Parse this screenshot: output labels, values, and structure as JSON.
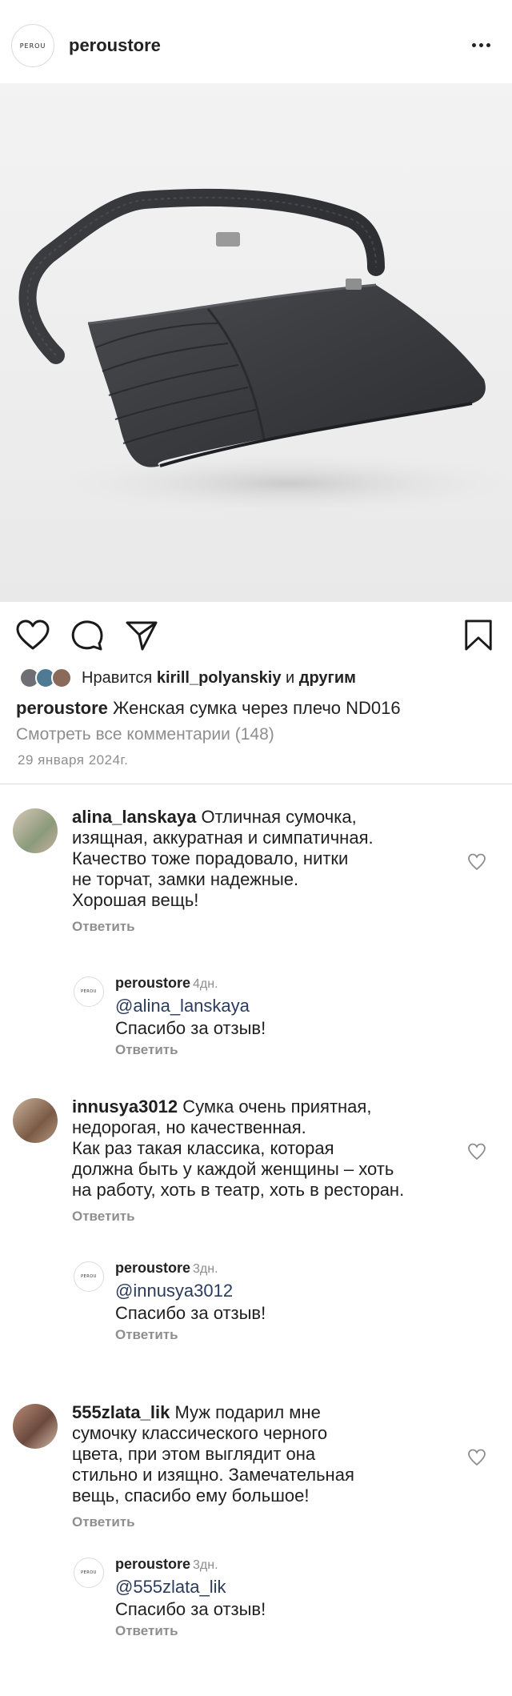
{
  "header": {
    "logo_text": "PEROU",
    "username": "peroustore"
  },
  "post": {
    "likes": {
      "prefix": "Нравится",
      "user": "kirill_polyanskiy",
      "connector": "и",
      "suffix": "другим"
    },
    "caption_user": "peroustore",
    "caption_text": "Женская сумка через плечо ND016",
    "view_comments": "Смотреть все комментарии (148)",
    "date": "29 января 2024г."
  },
  "comments": [
    {
      "user": "alina_lanskaya",
      "lines": [
        "Отличная сумочка,",
        "изящная, аккуратная и симпатичная.",
        "Качество тоже порадовало, нитки",
        "не торчат, замки надежные.",
        "Хорошая вещь!"
      ],
      "reply_label": "Ответить",
      "reply": {
        "user": "peroustore",
        "time": "4дн.",
        "mention": "@alina_lanskaya",
        "text": "Спасибо за отзыв!",
        "reply_label": "Ответить"
      }
    },
    {
      "user": "innusya3012",
      "lines": [
        "Сумка очень приятная,",
        "недорогая, но качественная.",
        "Как раз такая классика, которая",
        "должна быть у каждой женщины – хоть",
        "на работу, хоть в театр, хоть в ресторан."
      ],
      "reply_label": "Ответить",
      "reply": {
        "user": "peroustore",
        "time": "3дн.",
        "mention": "@innusya3012",
        "text": "Спасибо за отзыв!",
        "reply_label": "Ответить"
      }
    },
    {
      "user": "555zlata_lik",
      "lines": [
        "Муж подарил мне",
        "сумочку классического черного",
        "цвета, при этом выглядит она",
        "стильно и изящно. Замечательная",
        "вещь, спасибо ему большое!"
      ],
      "reply_label": "Ответить",
      "reply": {
        "user": "peroustore",
        "time": "3дн.",
        "mention": "@555zlata_lik",
        "text": "Спасибо за отзыв!",
        "reply_label": "Ответить"
      }
    }
  ]
}
